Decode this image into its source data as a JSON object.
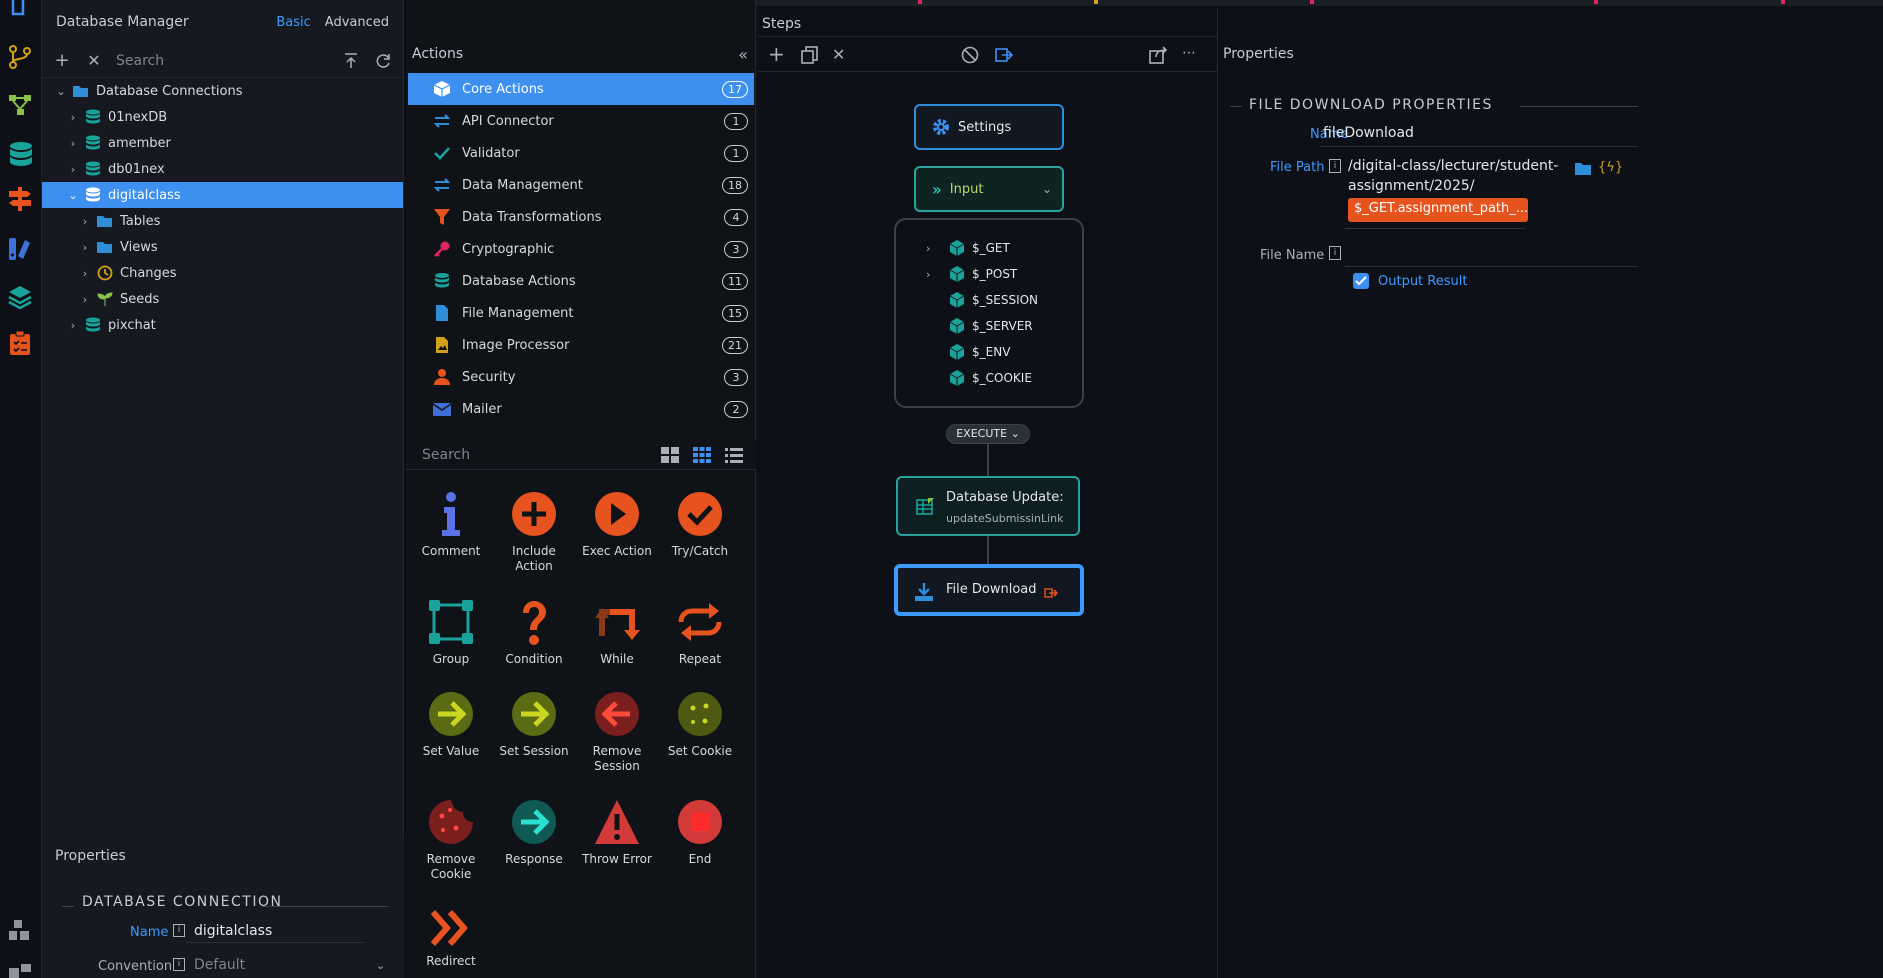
{
  "db_manager": {
    "title": "Database Manager",
    "mode_basic": "Basic",
    "mode_advanced": "Advanced",
    "search_placeholder": "Search",
    "tree": [
      {
        "label": "Database Connections",
        "level": 0,
        "expanded": true,
        "icon": "folder-icon"
      },
      {
        "label": "01nexDB",
        "level": 1,
        "icon": "database-icon"
      },
      {
        "label": "amember",
        "level": 1,
        "icon": "database-icon"
      },
      {
        "label": "db01nex",
        "level": 1,
        "icon": "database-icon"
      },
      {
        "label": "digitalclass",
        "level": 1,
        "expanded": true,
        "selected": true,
        "icon": "database-icon"
      },
      {
        "label": "Tables",
        "level": 2,
        "icon": "folder-icon"
      },
      {
        "label": "Views",
        "level": 2,
        "icon": "folder-icon"
      },
      {
        "label": "Changes",
        "level": 2,
        "icon": "history-icon"
      },
      {
        "label": "Seeds",
        "level": 2,
        "icon": "seedling-icon"
      },
      {
        "label": "pixchat",
        "level": 1,
        "icon": "database-icon"
      }
    ],
    "properties": {
      "header": "Properties",
      "section": "DATABASE CONNECTION",
      "name_label": "Name",
      "name_value": "digitalclass",
      "convention_label": "Convention",
      "convention_value": "Default"
    }
  },
  "actions": {
    "header": "Actions",
    "items": [
      {
        "label": "Core Actions",
        "count": "17",
        "selected": true,
        "icon": "cube-icon"
      },
      {
        "label": "API Connector",
        "count": "1",
        "icon": "exchange-icon"
      },
      {
        "label": "Validator",
        "count": "1",
        "icon": "check-icon"
      },
      {
        "label": "Data Management",
        "count": "18",
        "icon": "exchange-icon"
      },
      {
        "label": "Data Transformations",
        "count": "4",
        "icon": "filter-icon"
      },
      {
        "label": "Cryptographic",
        "count": "3",
        "icon": "key-icon"
      },
      {
        "label": "Database Actions",
        "count": "11",
        "icon": "database-icon"
      },
      {
        "label": "File Management",
        "count": "15",
        "icon": "file-icon"
      },
      {
        "label": "Image Processor",
        "count": "21",
        "icon": "image-file-icon"
      },
      {
        "label": "Security",
        "count": "3",
        "icon": "user-icon"
      },
      {
        "label": "Mailer",
        "count": "2",
        "icon": "envelope-icon"
      }
    ],
    "search_placeholder": "Search",
    "tools": [
      {
        "label": "Comment",
        "icon": "info-icon"
      },
      {
        "label": "Include Action",
        "icon": "plus-circle-icon"
      },
      {
        "label": "Exec Action",
        "icon": "play-circle-icon"
      },
      {
        "label": "Try/Catch",
        "icon": "check-circle-icon"
      },
      {
        "label": "Group",
        "icon": "group-icon"
      },
      {
        "label": "Condition",
        "icon": "question-icon"
      },
      {
        "label": "While",
        "icon": "while-icon"
      },
      {
        "label": "Repeat",
        "icon": "repeat-icon"
      },
      {
        "label": "Set Value",
        "icon": "arrow-right-circle-icon"
      },
      {
        "label": "Set Session",
        "icon": "arrow-right-circle-icon"
      },
      {
        "label": "Remove Session",
        "icon": "arrow-left-circle-icon"
      },
      {
        "label": "Set Cookie",
        "icon": "cookie-icon"
      },
      {
        "label": "Remove Cookie",
        "icon": "cookie-bite-icon"
      },
      {
        "label": "Response",
        "icon": "arrow-right-circle-icon"
      },
      {
        "label": "Throw Error",
        "icon": "warning-icon"
      },
      {
        "label": "End",
        "icon": "stop-circle-icon"
      },
      {
        "label": "Redirect",
        "icon": "double-chevron-right-icon"
      }
    ]
  },
  "steps": {
    "header": "Steps",
    "settings_label": "Settings",
    "input_label": "Input",
    "vars": [
      "$_GET",
      "$_POST",
      "$_SESSION",
      "$_SERVER",
      "$_ENV",
      "$_COOKIE"
    ],
    "execute_label": "EXECUTE",
    "db_update_title": "Database Update:",
    "db_update_sub": "updateSubmissinLink",
    "file_download_label": "File Download"
  },
  "properties": {
    "header": "Properties",
    "section": "FILE DOWNLOAD PROPERTIES",
    "name_label": "Name",
    "name_value": "fileDownload",
    "path_label": "File Path",
    "path_line1": "/digital-class/lecturer/student-",
    "path_line2": "assignment/2025/",
    "path_token": "$_GET.assignment_path_...",
    "filename_label": "File Name",
    "output_label": "Output Result"
  },
  "colors": {
    "accent": "#3d8ff0",
    "teal": "#19a39a",
    "orange": "#e6531e",
    "red": "#d33a3a"
  }
}
